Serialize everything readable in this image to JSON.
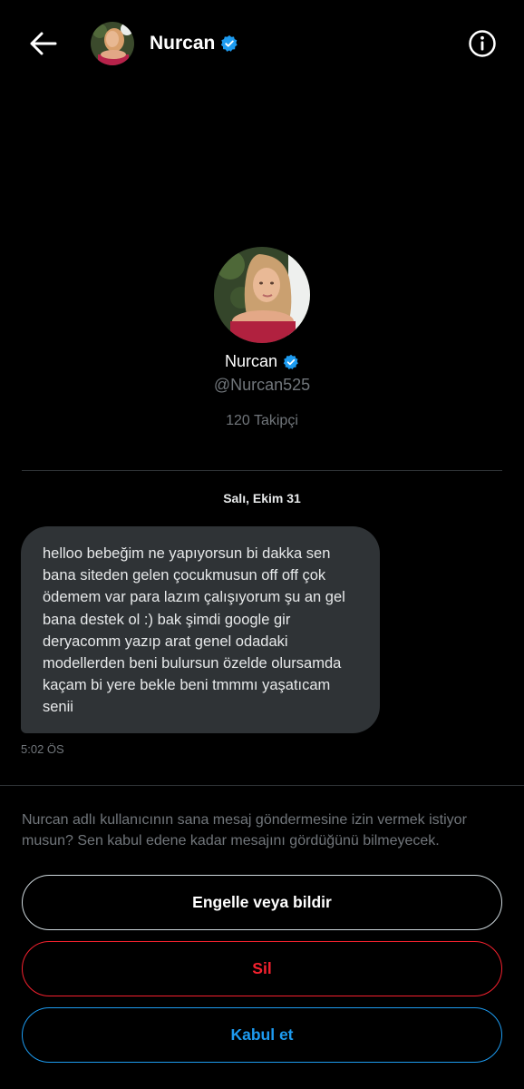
{
  "header": {
    "name": "Nurcan",
    "back_icon": "arrow-left-icon",
    "info_icon": "info-circle-icon"
  },
  "profile": {
    "name": "Nurcan",
    "handle": "@Nurcan525",
    "followers": "120 Takipçi",
    "verified_icon": "verified-badge-icon"
  },
  "conversation": {
    "date": "Salı, Ekim 31",
    "message": {
      "text": "helloo bebeğim ne yapıyorsun bi dakka sen bana siteden gelen çocukmusun off off çok ödemem var para lazım çalışıyorum şu an gel bana destek ol :) bak şimdi google gir deryacomm yazıp arat genel odadaki modellerden beni bulursun özelde olursamda kaçam bi yere bekle beni tmmmı yaşatıcam senii",
      "time": "5:02 ÖS"
    }
  },
  "request": {
    "notice": "Nurcan adlı kullanıcının sana mesaj göndermesine izin vermek istiyor musun? Sen kabul edene kadar mesajını gördüğünü bilmeyecek.",
    "block_label": "Engelle veya bildir",
    "delete_label": "Sil",
    "accept_label": "Kabul et"
  },
  "colors": {
    "background": "#000000",
    "bubble": "#2f3336",
    "muted_text": "#71767b",
    "accent": "#1d9bf0",
    "danger": "#f4212e"
  }
}
